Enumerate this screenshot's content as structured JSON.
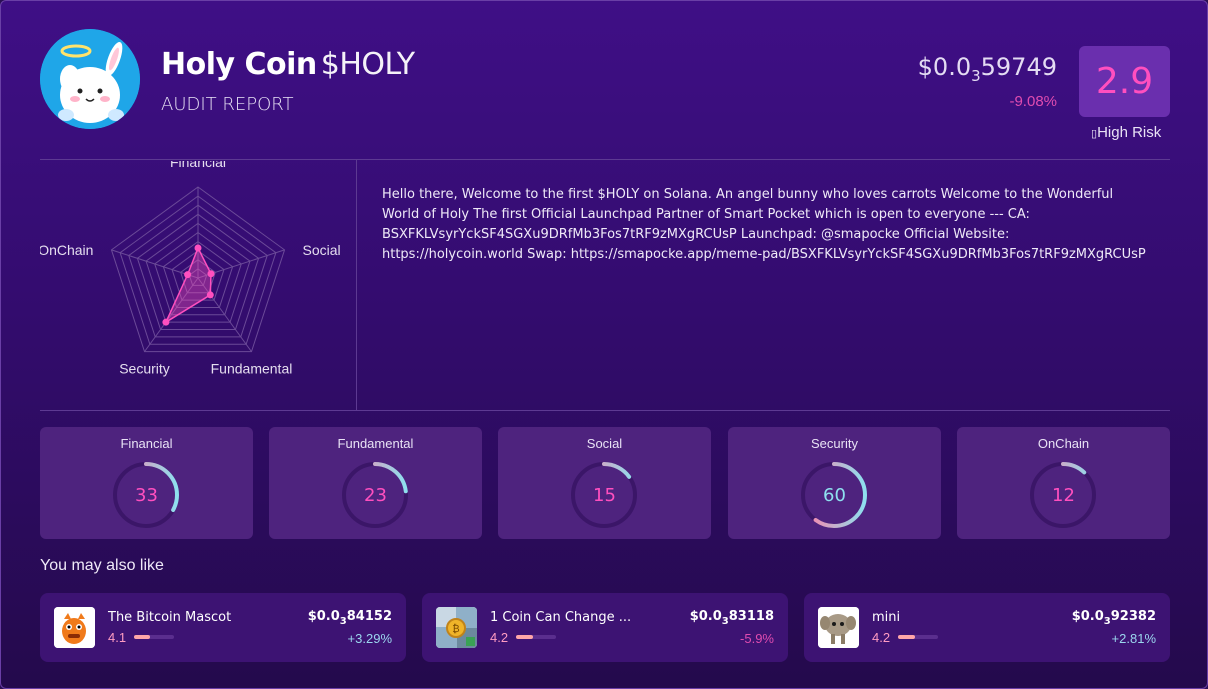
{
  "header": {
    "name": "Holy Coin",
    "ticker": "$HOLY",
    "subtitle": "AUDIT REPORT",
    "price_prefix": "$0.0",
    "price_zeros": "3",
    "price_digits": "59749",
    "change": "-9.08%",
    "score": "2.9",
    "risk_label": "High Risk"
  },
  "radar": {
    "axes": [
      "Financial",
      "Social",
      "Fundamental",
      "Security",
      "OnChain"
    ],
    "values": [
      33,
      15,
      23,
      60,
      12
    ],
    "max": 100
  },
  "description": "Hello there, Welcome to the first $HOLY on Solana. An angel bunny who loves carrots Welcome to the Wonderful World of Holy The first Official Launchpad Partner of Smart Pocket which is open to everyone  --- CA: BSXFKLVsyrYckSF4SGXu9DRfMb3Fos7tRF9zMXgRCUsP Launchpad: @smapocke Official Website: https://holycoin.world Swap: https://smapocke.app/meme-pad/BSXFKLVsyrYckSF4SGXu9DRfMb3Fos7tRF9zMXgRCUsP",
  "scores": [
    {
      "label": "Financial",
      "value": "33"
    },
    {
      "label": "Fundamental",
      "value": "23"
    },
    {
      "label": "Social",
      "value": "15"
    },
    {
      "label": "Security",
      "value": "60"
    },
    {
      "label": "OnChain",
      "value": "12"
    }
  ],
  "recommend_title": "You may also like",
  "recommendations": [
    {
      "name": "The Bitcoin Mascot",
      "score": "4.1",
      "price_prefix": "$0.0",
      "price_zeros": "3",
      "price_digits": "84152",
      "change": "+3.29%",
      "trend": "pos"
    },
    {
      "name": "1 Coin Can Change ...",
      "score": "4.2",
      "price_prefix": "$0.0",
      "price_zeros": "3",
      "price_digits": "83118",
      "change": "-5.9%",
      "trend": "neg"
    },
    {
      "name": "mini",
      "score": "4.2",
      "price_prefix": "$0.0",
      "price_zeros": "3",
      "price_digits": "92382",
      "change": "+2.81%",
      "trend": "pos"
    }
  ],
  "colors": {
    "accent_pink": "#ff4fbf",
    "accent_cyan": "#8ee0ef",
    "card_bg": "#4e237e",
    "rec_bg": "#3d1373"
  }
}
